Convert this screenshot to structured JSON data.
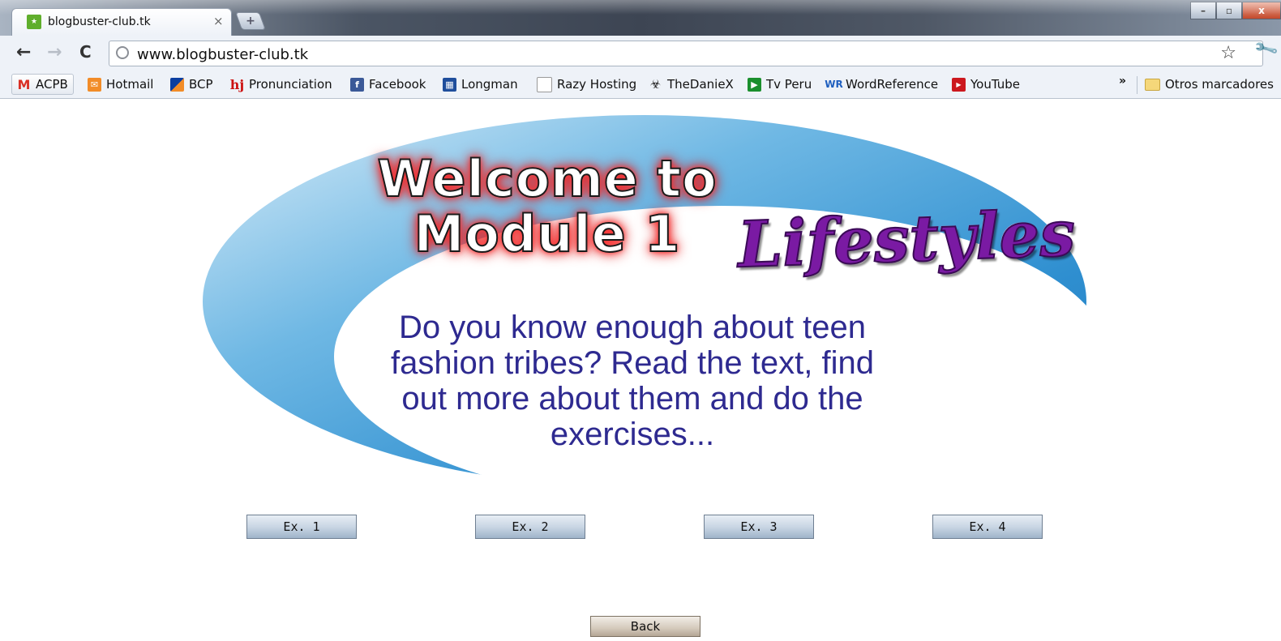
{
  "browser": {
    "tab": {
      "title": "blogbuster-club.tk",
      "favicon": "club-logo-icon",
      "close_glyph": "×",
      "new_tab_glyph": "+"
    },
    "window_controls": {
      "minimize": "–",
      "maximize": "▫",
      "close": "x"
    },
    "address_bar": {
      "url": "www.blogbuster-club.tk"
    },
    "bookmarks": [
      {
        "label": "ACPB",
        "icon": "gmail-icon",
        "color": "#d93025"
      },
      {
        "label": "Hotmail",
        "icon": "hotmail-icon",
        "color": "#f28c28"
      },
      {
        "label": "BCP",
        "icon": "bcp-icon",
        "color": "#0b3ea0"
      },
      {
        "label": "Pronunciation",
        "icon": "hj-icon",
        "color": "#cc1111"
      },
      {
        "label": "Facebook",
        "icon": "facebook-icon",
        "color": "#3b5998"
      },
      {
        "label": "Longman",
        "icon": "longman-icon",
        "color": "#1f4e9c"
      },
      {
        "label": "Razy Hosting",
        "icon": "page-icon",
        "color": "#ffffff"
      },
      {
        "label": "TheDanieX",
        "icon": "biohazard-icon",
        "color": "#333333"
      },
      {
        "label": "Tv Peru",
        "icon": "play-icon",
        "color": "#1a8f2d"
      },
      {
        "label": "WordReference",
        "icon": "wordreference-icon",
        "color": "#1f5fbf"
      },
      {
        "label": "YouTube",
        "icon": "youtube-icon",
        "color": "#cc181e"
      }
    ],
    "overflow": "»",
    "other_bookmarks": "Otros marcadores"
  },
  "page": {
    "welcome_line1": "Welcome to",
    "welcome_line2": "Module 1",
    "module_name": "Lifestyles",
    "intro": "Do you know enough about teen fashion tribes? Read the text, find out more about them and do the exercises...",
    "exercises": [
      "Ex. 1",
      "Ex. 2",
      "Ex. 3",
      "Ex. 4"
    ],
    "back": "Back"
  },
  "colors": {
    "swoosh_blue": "#2f8fd0",
    "intro_text": "#2e2a90",
    "lifestyles_purple": "#7a1aa3",
    "welcome_glow": "#ff2020"
  }
}
